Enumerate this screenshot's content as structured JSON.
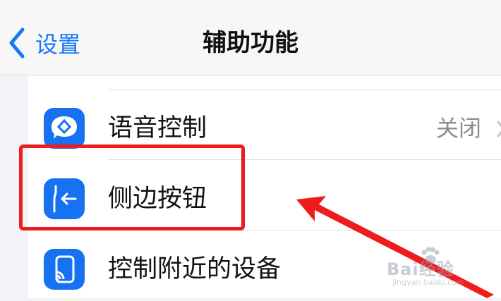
{
  "nav": {
    "back_label": "设置",
    "title": "辅助功能"
  },
  "rows": [
    {
      "label": "语音控制",
      "value": "关闭",
      "icon": "voice-control-icon"
    },
    {
      "label": "侧边按钮",
      "value": "",
      "icon": "side-button-icon"
    },
    {
      "label": "控制附近的设备",
      "value": "",
      "icon": "nearby-devices-icon"
    }
  ],
  "colors": {
    "accent": "#1479f5",
    "icon_tile": "#1672f0",
    "highlight": "#ee1c1c"
  },
  "watermark": {
    "brand": "Bai经验",
    "url": "jingyan.baidu.com"
  }
}
